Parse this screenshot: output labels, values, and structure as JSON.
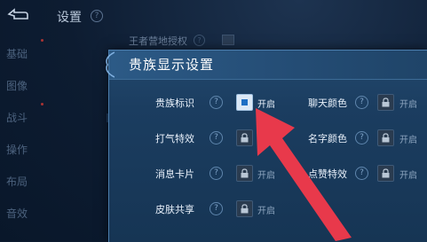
{
  "settings": {
    "title": "设置",
    "help_glyph": "?",
    "menu": [
      {
        "label": "基础"
      },
      {
        "label": "图像"
      },
      {
        "label": "战斗"
      },
      {
        "label": "操作"
      },
      {
        "label": "布局"
      },
      {
        "label": "音效"
      }
    ],
    "row_label": "王者营地授权"
  },
  "modal": {
    "title": "贵族显示设置",
    "options": [
      {
        "label": "贵族标识",
        "state": "开启",
        "enabled": true,
        "locked": false
      },
      {
        "label": "打气特效",
        "state": "开启",
        "enabled": false,
        "locked": true
      },
      {
        "label": "消息卡片",
        "state": "开启",
        "enabled": false,
        "locked": true
      },
      {
        "label": "皮肤共享",
        "state": "开启",
        "enabled": false,
        "locked": true
      },
      {
        "label": "聊天颜色",
        "state": "开启",
        "enabled": false,
        "locked": true
      },
      {
        "label": "名字颜色",
        "state": "开启",
        "enabled": false,
        "locked": true
      },
      {
        "label": "点赞特效",
        "state": "开启",
        "enabled": false,
        "locked": true
      }
    ]
  },
  "colors": {
    "arrow": "#e8394b",
    "accent_blue": "#1e6fc4",
    "modal_bg": "#1b3d60"
  }
}
